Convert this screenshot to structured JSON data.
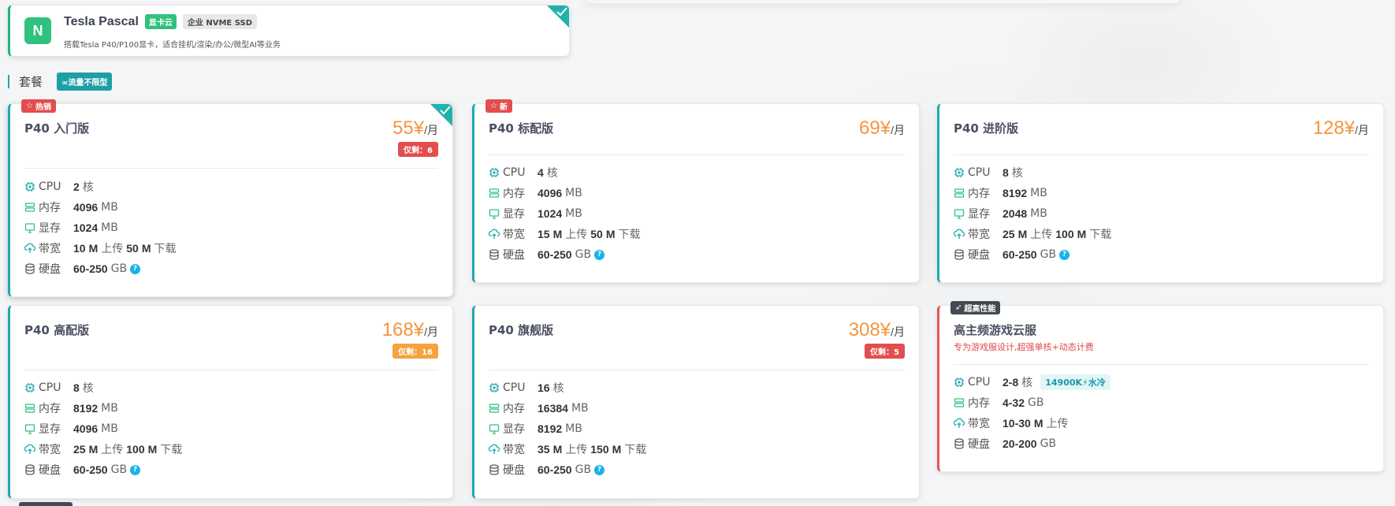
{
  "product": {
    "logo": "N",
    "title": "Tesla Pascal",
    "tags": [
      "显卡云",
      "企业 NVME SSD"
    ],
    "description": "搭载Tesla P40/P100显卡，适合挂机/渲染/办公/微型AI等业务"
  },
  "section": {
    "title": "套餐",
    "tag": "∞流量不限型"
  },
  "spec_labels": {
    "cpu": "CPU",
    "mem": "内存",
    "vram": "显存",
    "bw": "带宽",
    "disk": "硬盘",
    "help": "?"
  },
  "units": {
    "core": "核",
    "mb": "MB",
    "gb": "GB",
    "m": "M",
    "up": "上传",
    "down": "下载",
    "per_month": "/月",
    "currency": "¥"
  },
  "plans": [
    {
      "badge": "热销",
      "name": "P40 入门版",
      "price": "55",
      "stock": "仅剩：6",
      "cpu": "2",
      "mem": "4096",
      "vram": "1024",
      "bw_up": "10",
      "bw_down": "50",
      "disk": "60-250"
    },
    {
      "badge": "新",
      "name": "P40 标配版",
      "price": "69",
      "cpu": "4",
      "mem": "4096",
      "vram": "1024",
      "bw_up": "15",
      "bw_down": "50",
      "disk": "60-250"
    },
    {
      "name": "P40 进阶版",
      "price": "128",
      "cpu": "8",
      "mem": "8192",
      "vram": "2048",
      "bw_up": "25",
      "bw_down": "100",
      "disk": "60-250"
    },
    {
      "name": "P40 高配版",
      "price": "168",
      "stock": "仅剩：16",
      "cpu": "8",
      "mem": "8192",
      "vram": "4096",
      "bw_up": "25",
      "bw_down": "100",
      "disk": "60-250"
    },
    {
      "name": "P40 旗舰版",
      "price": "308",
      "stock": "仅剩：5",
      "cpu": "16",
      "mem": "16384",
      "vram": "8192",
      "bw_up": "35",
      "bw_down": "150",
      "disk": "60-250"
    },
    {
      "badge": "超高性能",
      "name": "高主频游戏云服",
      "subtitle": "专为游戏服设计,超强单核+动态计费",
      "cpu": "2-8",
      "cpu_tag": "14900K⚡水冷",
      "mem": "4-32",
      "bw": "10-30",
      "disk": "20-200"
    }
  ],
  "colors": {
    "accent": "#20a8b0",
    "price": "#f5953e",
    "stock_red": "#e34d4d",
    "stock_orange": "#f5a340",
    "brand_green": "#2ec27e"
  }
}
